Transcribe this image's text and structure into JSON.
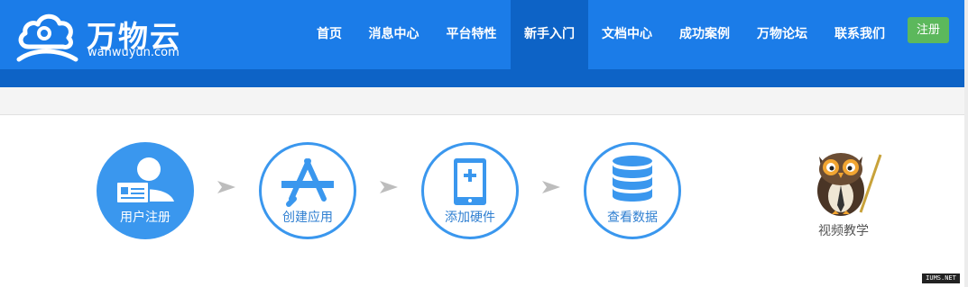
{
  "brand": {
    "title": "万物云",
    "subtitle": "wanwuyun.com"
  },
  "nav": {
    "items": [
      {
        "label": "首页"
      },
      {
        "label": "消息中心"
      },
      {
        "label": "平台特性"
      },
      {
        "label": "新手入门",
        "active": true
      },
      {
        "label": "文档中心"
      },
      {
        "label": "成功案例"
      },
      {
        "label": "万物论坛"
      },
      {
        "label": "联系我们"
      }
    ],
    "register_label": "注册"
  },
  "steps": [
    {
      "label": "用户注册",
      "icon": "user-card-icon",
      "style": "filled"
    },
    {
      "label": "创建应用",
      "icon": "app-store-icon",
      "style": "outline"
    },
    {
      "label": "添加硬件",
      "icon": "tablet-add-icon",
      "style": "outline"
    },
    {
      "label": "查看数据",
      "icon": "database-icon",
      "style": "outline"
    }
  ],
  "video": {
    "label": "视频教学",
    "icon": "owl-teacher-icon"
  },
  "watermark": "IUMS.NET",
  "colors": {
    "header": "#1b7ce8",
    "header_dark": "#0d63c6",
    "accent": "#3a97ee",
    "register": "#5cb85c"
  }
}
